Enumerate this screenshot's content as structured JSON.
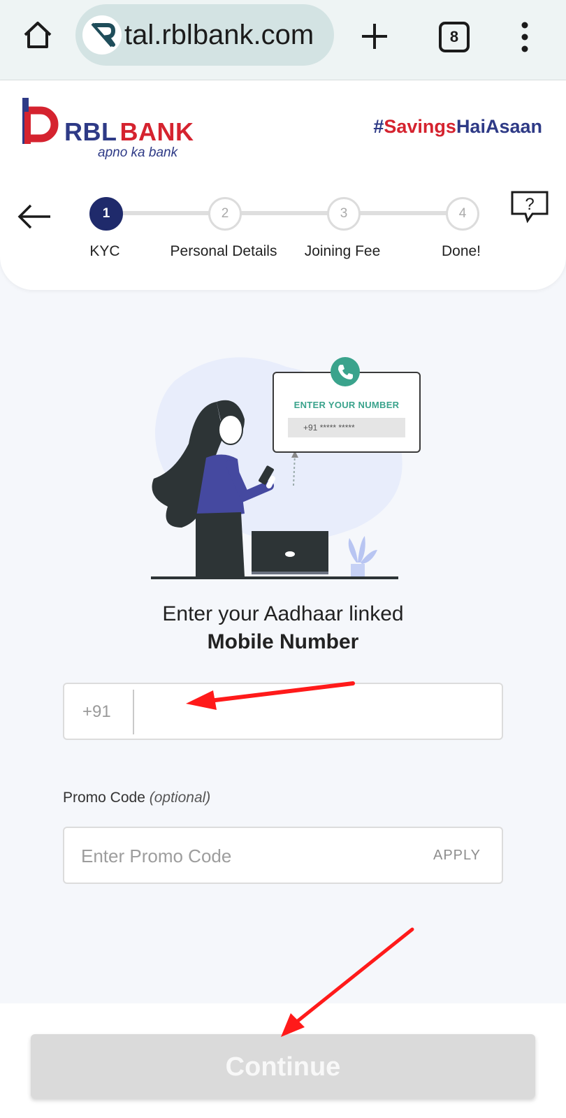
{
  "browser": {
    "url": "tal.rblbank.com",
    "tab_count": "8",
    "icons": {
      "home": "home-icon",
      "new_tab": "plus-icon",
      "menu": "kebab-menu-icon"
    }
  },
  "brand": {
    "name_part1": "RBL",
    "name_part2": "BANK",
    "tagline": "apno ka bank",
    "hashtag_part1": "#",
    "hashtag_part2": "Savings",
    "hashtag_part3": "HaiAsaan",
    "colors": {
      "navy": "#2e3a86",
      "red": "#d5232f"
    }
  },
  "stepper": {
    "steps": [
      {
        "number": "1",
        "label": "KYC",
        "active": true
      },
      {
        "number": "2",
        "label": "Personal Details",
        "active": false
      },
      {
        "number": "3",
        "label": "Joining Fee",
        "active": false
      },
      {
        "number": "4",
        "label": "Done!",
        "active": false
      }
    ]
  },
  "illustration": {
    "card_title": "ENTER YOUR NUMBER",
    "card_number": "+91 ***** *****"
  },
  "form": {
    "prompt_line1": "Enter your Aadhaar linked",
    "prompt_line2": "Mobile Number",
    "country_code": "+91",
    "mobile_value": "",
    "promo_label": "Promo Code",
    "promo_optional": "(optional)",
    "promo_placeholder": "Enter Promo Code",
    "apply_label": "APPLY"
  },
  "footer": {
    "continue_label": "Continue"
  },
  "colors": {
    "accent_navy": "#1f2a6b",
    "annotation_red": "#ff1a1a",
    "disabled_button": "#dadada"
  }
}
